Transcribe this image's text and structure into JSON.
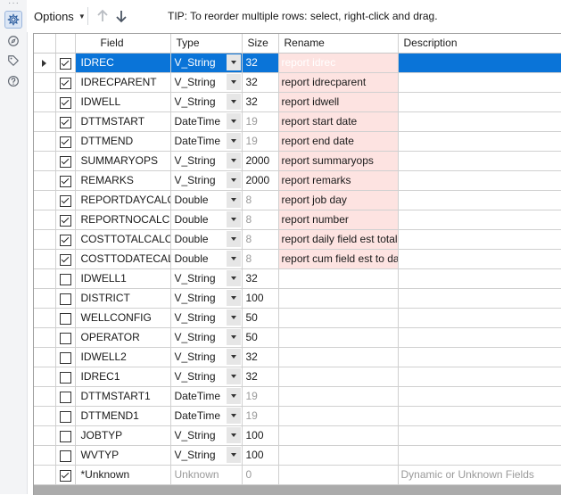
{
  "toolbar": {
    "options_label": "Options",
    "tip": "TIP: To reorder multiple rows: select, right-click and drag."
  },
  "rail": {
    "icons": [
      "gear-icon",
      "compass-icon",
      "tag-icon",
      "help-icon"
    ]
  },
  "grid": {
    "columns": {
      "field": "Field",
      "type": "Type",
      "size": "Size",
      "rename": "Rename",
      "description": "Description"
    },
    "rows": [
      {
        "checked": true,
        "field": "IDREC",
        "type": "V_String",
        "size": "32",
        "size_dim": false,
        "rename": "report idrec",
        "desc": ""
      },
      {
        "checked": true,
        "field": "IDRECPARENT",
        "type": "V_String",
        "size": "32",
        "size_dim": false,
        "rename": "report idrecparent",
        "desc": ""
      },
      {
        "checked": true,
        "field": "IDWELL",
        "type": "V_String",
        "size": "32",
        "size_dim": false,
        "rename": "report idwell",
        "desc": ""
      },
      {
        "checked": true,
        "field": "DTTMSTART",
        "type": "DateTime",
        "size": "19",
        "size_dim": true,
        "rename": "report start date",
        "desc": ""
      },
      {
        "checked": true,
        "field": "DTTMEND",
        "type": "DateTime",
        "size": "19",
        "size_dim": true,
        "rename": "report end date",
        "desc": ""
      },
      {
        "checked": true,
        "field": "SUMMARYOPS",
        "type": "V_String",
        "size": "2000",
        "size_dim": false,
        "rename": "report summaryops",
        "desc": ""
      },
      {
        "checked": true,
        "field": "REMARKS",
        "type": "V_String",
        "size": "2000",
        "size_dim": false,
        "rename": "report remarks",
        "desc": ""
      },
      {
        "checked": true,
        "field": "REPORTDAYCALC",
        "type": "Double",
        "size": "8",
        "size_dim": true,
        "rename": "report job day",
        "desc": ""
      },
      {
        "checked": true,
        "field": "REPORTNOCALC",
        "type": "Double",
        "size": "8",
        "size_dim": true,
        "rename": "report number",
        "desc": ""
      },
      {
        "checked": true,
        "field": "COSTTOTALCALC",
        "type": "Double",
        "size": "8",
        "size_dim": true,
        "rename": "report daily field est total",
        "desc": ""
      },
      {
        "checked": true,
        "field": "COSTTODATECALC",
        "type": "Double",
        "size": "8",
        "size_dim": true,
        "rename": "report cum field est to date",
        "desc": ""
      },
      {
        "checked": false,
        "field": "IDWELL1",
        "type": "V_String",
        "size": "32",
        "size_dim": false,
        "rename": "",
        "desc": ""
      },
      {
        "checked": false,
        "field": "DISTRICT",
        "type": "V_String",
        "size": "100",
        "size_dim": false,
        "rename": "",
        "desc": ""
      },
      {
        "checked": false,
        "field": "WELLCONFIG",
        "type": "V_String",
        "size": "50",
        "size_dim": false,
        "rename": "",
        "desc": ""
      },
      {
        "checked": false,
        "field": "OPERATOR",
        "type": "V_String",
        "size": "50",
        "size_dim": false,
        "rename": "",
        "desc": ""
      },
      {
        "checked": false,
        "field": "IDWELL2",
        "type": "V_String",
        "size": "32",
        "size_dim": false,
        "rename": "",
        "desc": ""
      },
      {
        "checked": false,
        "field": "IDREC1",
        "type": "V_String",
        "size": "32",
        "size_dim": false,
        "rename": "",
        "desc": ""
      },
      {
        "checked": false,
        "field": "DTTMSTART1",
        "type": "DateTime",
        "size": "19",
        "size_dim": true,
        "rename": "",
        "desc": ""
      },
      {
        "checked": false,
        "field": "DTTMEND1",
        "type": "DateTime",
        "size": "19",
        "size_dim": true,
        "rename": "",
        "desc": ""
      },
      {
        "checked": false,
        "field": "JOBTYP",
        "type": "V_String",
        "size": "100",
        "size_dim": false,
        "rename": "",
        "desc": ""
      },
      {
        "checked": false,
        "field": "WVTYP",
        "type": "V_String",
        "size": "100",
        "size_dim": false,
        "rename": "",
        "desc": ""
      },
      {
        "checked": true,
        "field": "*Unknown",
        "type": "Unknown",
        "size": "0",
        "size_dim": true,
        "rename": "",
        "desc": "Dynamic or Unknown Fields",
        "unknown": true
      }
    ],
    "selected_row": 0
  },
  "colors": {
    "selection": "#0a74d8",
    "rename_highlight": "#fde3e1"
  }
}
